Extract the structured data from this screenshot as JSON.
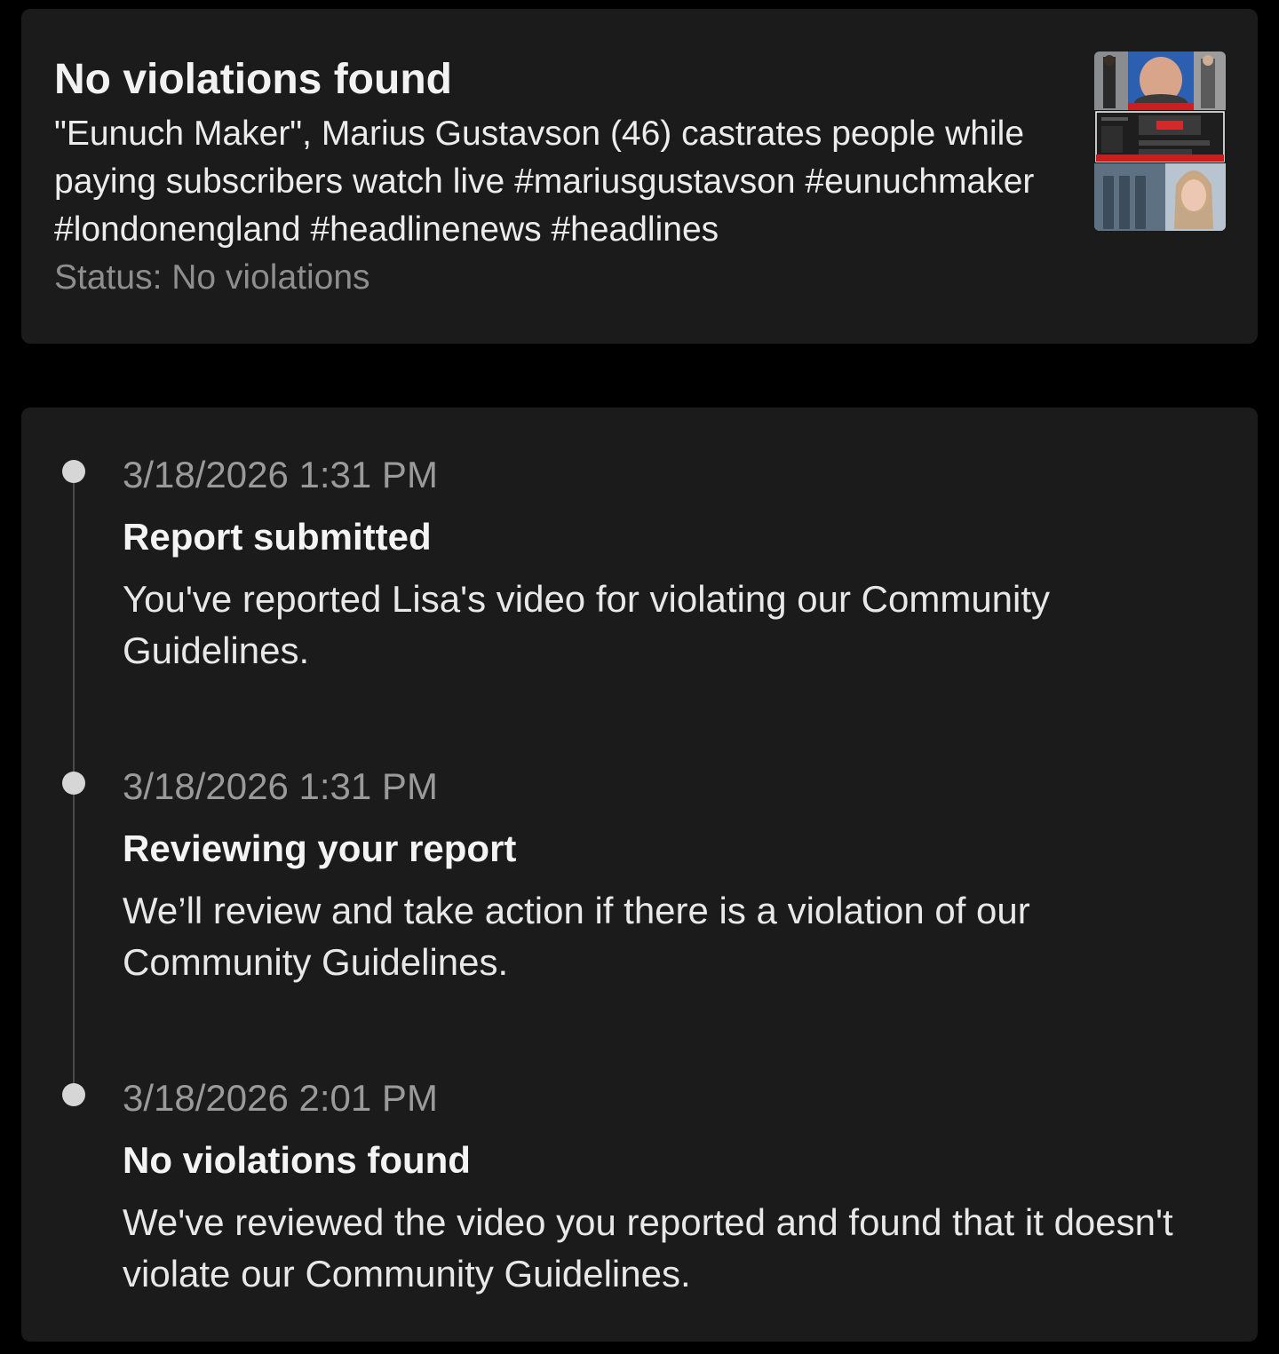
{
  "summary": {
    "title": "No violations found",
    "description": "\"Eunuch Maker\", Marius Gustavson (46) castrates people while paying subscribers watch live #mariusgustavson #eunuchmaker #londonengland #headlinenews #headlines",
    "status": "Status: No violations",
    "thumbnail_icon": "video-thumbnail"
  },
  "timeline": {
    "events": [
      {
        "time": "3/18/2026 1:31 PM",
        "title": "Report submitted",
        "body": "You've reported Lisa's video for violating our Community Guidelines."
      },
      {
        "time": "3/18/2026 1:31 PM",
        "title": "Reviewing your report",
        "body": "We’ll review and take action if there is a violation of our Community Guidelines."
      },
      {
        "time": "3/18/2026 2:01 PM",
        "title": "No violations found",
        "body": "We've reviewed the video you reported and found that it doesn't violate our Community Guidelines."
      }
    ]
  },
  "colors": {
    "background": "#000000",
    "card": "#1b1b1b",
    "dot": "#d6d6d6",
    "secondary_text": "#8e8e8e"
  }
}
